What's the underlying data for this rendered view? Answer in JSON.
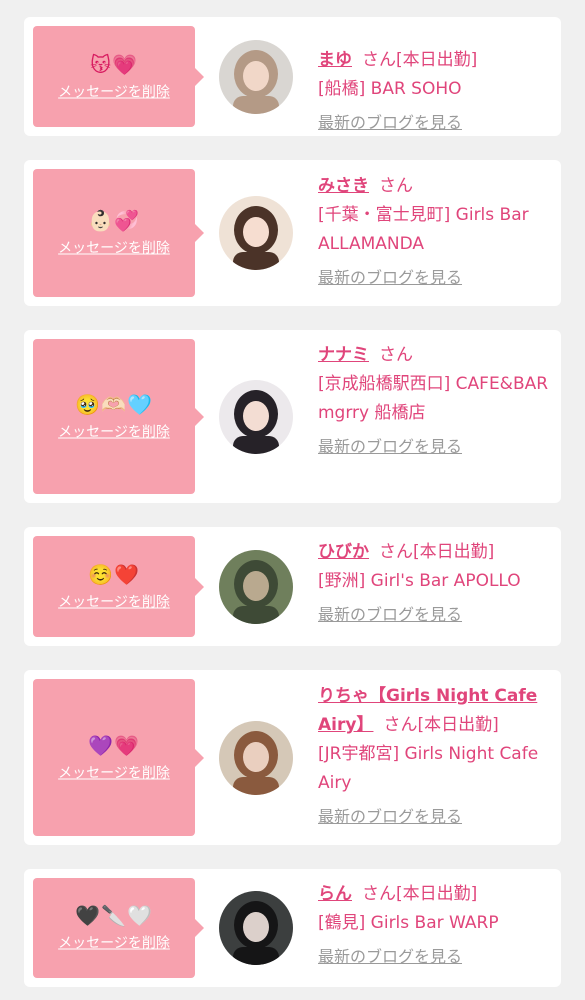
{
  "entries": [
    {
      "emoji": "😽💗",
      "delete_label": "メッセージを削除",
      "name": "まゆ",
      "honorific": "さん",
      "status": "[本日出勤]",
      "shop": "[船橋] BAR SOHO",
      "blog_label": "最新のブログを見る",
      "avatar_colors": {
        "bg": "#d9d6d2",
        "hair": "#b49a86",
        "skin": "#f1d7c8"
      }
    },
    {
      "emoji": "👶🏻💞",
      "delete_label": "メッセージを削除",
      "name": "みさき",
      "honorific": "さん",
      "status": "",
      "shop": "[千葉・富士見町] Girls Bar ALLAMANDA",
      "blog_label": "最新のブログを見る",
      "avatar_colors": {
        "bg": "#efe2d6",
        "hair": "#4b3328",
        "skin": "#f6ddd0"
      }
    },
    {
      "emoji": "🥹🫶🏻🩵",
      "delete_label": "メッセージを削除",
      "name": "ナナミ",
      "honorific": "さん",
      "status": "",
      "shop": "[京成船橋駅西口] CAFE&BAR mgrry 船橋店",
      "blog_label": "最新のブログを見る",
      "avatar_colors": {
        "bg": "#ece9ec",
        "hair": "#262228",
        "skin": "#f3ddd3"
      }
    },
    {
      "emoji": "☺️❤️",
      "delete_label": "メッセージを削除",
      "name": "ひびか",
      "honorific": "さん",
      "status": "[本日出勤]",
      "shop": "[野洲] Girl's Bar APOLLO",
      "blog_label": "最新のブログを見る",
      "avatar_colors": {
        "bg": "#6f7f5c",
        "hair": "#3e4a36",
        "skin": "#b9a98f"
      }
    },
    {
      "emoji": "💜💗",
      "delete_label": "メッセージを削除",
      "name": "りちゃ【Girls Night Cafe Airy】",
      "honorific": "さん",
      "status": "[本日出勤]",
      "shop": "[JR宇都宮] Girls Night Cafe Airy",
      "blog_label": "最新のブログを見る",
      "avatar_colors": {
        "bg": "#d5c8b7",
        "hair": "#8a5a3e",
        "skin": "#eacfbf"
      }
    },
    {
      "emoji": "🖤🔪🤍",
      "delete_label": "メッセージを削除",
      "name": "らん",
      "honorific": "さん",
      "status": "[本日出勤]",
      "shop": "[鶴見] Girls Bar WARP",
      "blog_label": "最新のブログを見る",
      "avatar_colors": {
        "bg": "#3c3f3f",
        "hair": "#151516",
        "skin": "#dcd0cb"
      }
    }
  ]
}
